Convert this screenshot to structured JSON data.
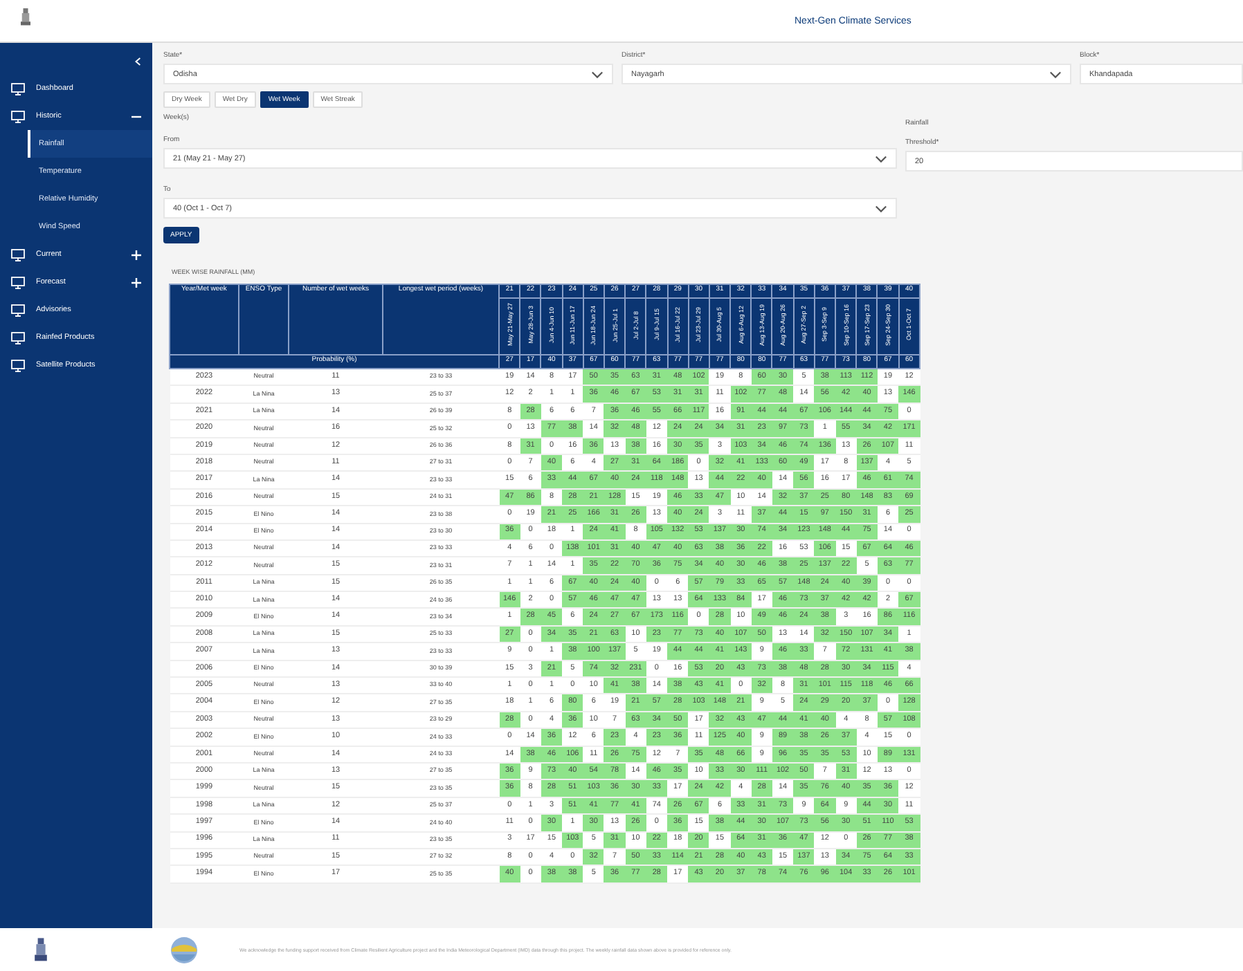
{
  "header": {
    "title": "Next-Gen Climate Services"
  },
  "sidebar": {
    "items": [
      {
        "label": "Dashboard"
      },
      {
        "label": "Historic",
        "expanded": true,
        "children": [
          {
            "label": "Rainfall",
            "selected": true
          },
          {
            "label": "Temperature",
            "selected": false
          },
          {
            "label": "Relative Humidity",
            "selected": false
          },
          {
            "label": "Wind Speed",
            "selected": false
          }
        ]
      },
      {
        "label": "Current",
        "expanded": false
      },
      {
        "label": "Forecast",
        "expanded": false
      },
      {
        "label": "Advisories"
      },
      {
        "label": "Rainfed Products"
      },
      {
        "label": "Satellite Products"
      }
    ]
  },
  "filters": [
    {
      "label": "State*",
      "value": "Odisha"
    },
    {
      "label": "District*",
      "value": "Nayagarh"
    },
    {
      "label": "Block*",
      "value": "Khandapada"
    }
  ],
  "tabs": [
    {
      "label": "Dry Week",
      "selected": false
    },
    {
      "label": "Wet Dry",
      "selected": false
    },
    {
      "label": "Wet Week",
      "selected": true
    },
    {
      "label": "Wet Streak",
      "selected": false
    }
  ],
  "weeks_section": {
    "label": "Week(s)",
    "from": {
      "label": "From",
      "value": "21 (May 21 - May 27)"
    },
    "to": {
      "label": "To",
      "value": "40 (Oct 1 - Oct 7)"
    },
    "apply": "APPLY"
  },
  "rainfall_section": {
    "label": "Rainfall",
    "threshold": {
      "label": "Threshold*",
      "value": "20"
    }
  },
  "table": {
    "caption": "WEEK WISE RAINFALL (MM)",
    "columns": [
      "Year/Met week",
      "ENSO Type",
      "Number of wet weeks",
      "Longest wet period (weeks)"
    ],
    "weeks": [
      {
        "number": "21",
        "dates": "May 21-May 27"
      },
      {
        "number": "22",
        "dates": "May 28-Jun 3"
      },
      {
        "number": "23",
        "dates": "Jun 4-Jun 10"
      },
      {
        "number": "24",
        "dates": "Jun 11-Jun 17"
      },
      {
        "number": "25",
        "dates": "Jun 18-Jun 24"
      },
      {
        "number": "26",
        "dates": "Jun 25-Jul 1"
      },
      {
        "number": "27",
        "dates": "Jul 2-Jul 8"
      },
      {
        "number": "28",
        "dates": "Jul 9-Jul 15"
      },
      {
        "number": "29",
        "dates": "Jul 16-Jul 22"
      },
      {
        "number": "30",
        "dates": "Jul 23-Jul 29"
      },
      {
        "number": "31",
        "dates": "Jul 30-Aug 5"
      },
      {
        "number": "32",
        "dates": "Aug 6-Aug 12"
      },
      {
        "number": "33",
        "dates": "Aug 13-Aug 19"
      },
      {
        "number": "34",
        "dates": "Aug 20-Aug 26"
      },
      {
        "number": "35",
        "dates": "Aug 27-Sep 2"
      },
      {
        "number": "36",
        "dates": "Sep 3-Sep 9"
      },
      {
        "number": "37",
        "dates": "Sep 10-Sep 16"
      },
      {
        "number": "38",
        "dates": "Sep 17-Sep 23"
      },
      {
        "number": "39",
        "dates": "Sep 24-Sep 30"
      },
      {
        "number": "40",
        "dates": "Oct 1-Oct 7"
      }
    ],
    "probability_label": "Probability (%)",
    "probability": [
      "27",
      "17",
      "40",
      "37",
      "67",
      "60",
      "77",
      "63",
      "77",
      "77",
      "77",
      "80",
      "80",
      "77",
      "63",
      "77",
      "73",
      "80",
      "67",
      "60"
    ],
    "rows": [
      {
        "year": "2023",
        "enso": "Neutral",
        "wet_weeks": "11",
        "longest": "23 to 33",
        "values": [
          "19",
          "14",
          "8",
          "17",
          "50",
          "35",
          "63",
          "31",
          "48",
          "102",
          "19",
          "8",
          "60",
          "30",
          "5",
          "38",
          "113",
          "112",
          "19",
          "12"
        ],
        "wet": [
          false,
          false,
          false,
          false,
          true,
          true,
          true,
          true,
          true,
          true,
          false,
          false,
          true,
          true,
          false,
          true,
          true,
          true,
          false,
          false
        ]
      },
      {
        "year": "2022",
        "enso": "La Nina",
        "wet_weeks": "13",
        "longest": "25 to 37",
        "values": [
          "12",
          "2",
          "1",
          "1",
          "36",
          "46",
          "67",
          "53",
          "31",
          "31",
          "11",
          "102",
          "77",
          "48",
          "14",
          "56",
          "42",
          "40",
          "13",
          "146"
        ],
        "wet": [
          false,
          false,
          false,
          false,
          true,
          true,
          true,
          true,
          true,
          true,
          false,
          true,
          true,
          true,
          false,
          true,
          true,
          true,
          false,
          true
        ]
      },
      {
        "year": "2021",
        "enso": "La Nina",
        "wet_weeks": "14",
        "longest": "26 to 39",
        "values": [
          "8",
          "28",
          "6",
          "6",
          "7",
          "36",
          "46",
          "55",
          "66",
          "117",
          "16",
          "91",
          "44",
          "44",
          "67",
          "106",
          "144",
          "44",
          "75",
          "0"
        ],
        "wet": [
          false,
          true,
          false,
          false,
          false,
          true,
          true,
          true,
          true,
          true,
          false,
          true,
          true,
          true,
          true,
          true,
          true,
          true,
          true,
          false
        ]
      },
      {
        "year": "2020",
        "enso": "Neutral",
        "wet_weeks": "16",
        "longest": "25 to 32",
        "values": [
          "0",
          "13",
          "77",
          "38",
          "14",
          "32",
          "48",
          "12",
          "24",
          "24",
          "34",
          "31",
          "23",
          "97",
          "73",
          "1",
          "55",
          "34",
          "42",
          "171"
        ],
        "wet": [
          false,
          false,
          true,
          true,
          false,
          true,
          true,
          false,
          true,
          true,
          true,
          true,
          true,
          true,
          true,
          false,
          true,
          true,
          true,
          true
        ]
      },
      {
        "year": "2019",
        "enso": "Neutral",
        "wet_weeks": "12",
        "longest": "26 to 36",
        "values": [
          "8",
          "31",
          "0",
          "16",
          "36",
          "13",
          "38",
          "16",
          "30",
          "35",
          "3",
          "103",
          "34",
          "46",
          "74",
          "136",
          "13",
          "26",
          "107",
          "11"
        ],
        "wet": [
          false,
          true,
          false,
          false,
          true,
          false,
          true,
          false,
          true,
          true,
          false,
          true,
          true,
          true,
          true,
          true,
          false,
          true,
          true,
          false
        ]
      },
      {
        "year": "2018",
        "enso": "Neutral",
        "wet_weeks": "11",
        "longest": "27 to 31",
        "values": [
          "0",
          "7",
          "40",
          "6",
          "4",
          "27",
          "31",
          "64",
          "186",
          "0",
          "32",
          "41",
          "133",
          "60",
          "49",
          "17",
          "8",
          "137",
          "4",
          "5"
        ],
        "wet": [
          false,
          false,
          true,
          false,
          false,
          true,
          true,
          true,
          true,
          false,
          true,
          true,
          true,
          true,
          true,
          false,
          false,
          true,
          false,
          false
        ]
      },
      {
        "year": "2017",
        "enso": "La Nina",
        "wet_weeks": "14",
        "longest": "23 to 33",
        "values": [
          "15",
          "6",
          "33",
          "44",
          "67",
          "40",
          "24",
          "118",
          "148",
          "13",
          "44",
          "22",
          "40",
          "14",
          "56",
          "16",
          "17",
          "46",
          "61",
          "74"
        ],
        "wet": [
          false,
          false,
          true,
          true,
          true,
          true,
          true,
          true,
          true,
          false,
          true,
          true,
          true,
          false,
          true,
          false,
          false,
          true,
          true,
          true
        ]
      },
      {
        "year": "2016",
        "enso": "Neutral",
        "wet_weeks": "15",
        "longest": "24 to 31",
        "values": [
          "47",
          "86",
          "8",
          "28",
          "21",
          "128",
          "15",
          "19",
          "46",
          "33",
          "47",
          "10",
          "14",
          "32",
          "37",
          "25",
          "80",
          "148",
          "83",
          "69"
        ],
        "wet": [
          true,
          true,
          false,
          true,
          true,
          true,
          false,
          false,
          true,
          true,
          true,
          false,
          false,
          true,
          true,
          true,
          true,
          true,
          true,
          true
        ]
      },
      {
        "year": "2015",
        "enso": "El Nino",
        "wet_weeks": "14",
        "longest": "23 to 38",
        "values": [
          "0",
          "19",
          "21",
          "25",
          "166",
          "31",
          "26",
          "13",
          "40",
          "24",
          "3",
          "11",
          "37",
          "44",
          "15",
          "97",
          "150",
          "31",
          "6",
          "25"
        ],
        "wet": [
          false,
          false,
          true,
          true,
          true,
          true,
          true,
          false,
          true,
          true,
          false,
          false,
          true,
          true,
          true,
          true,
          true,
          true,
          false,
          true
        ]
      },
      {
        "year": "2014",
        "enso": "El Nino",
        "wet_weeks": "14",
        "longest": "23 to 30",
        "values": [
          "36",
          "0",
          "18",
          "1",
          "24",
          "41",
          "8",
          "105",
          "132",
          "53",
          "137",
          "30",
          "74",
          "34",
          "123",
          "148",
          "44",
          "75",
          "14",
          "0"
        ],
        "wet": [
          true,
          false,
          false,
          false,
          true,
          true,
          false,
          true,
          true,
          true,
          true,
          true,
          true,
          true,
          true,
          true,
          true,
          true,
          false,
          false
        ]
      },
      {
        "year": "2013",
        "enso": "Neutral",
        "wet_weeks": "14",
        "longest": "23 to 33",
        "values": [
          "4",
          "6",
          "0",
          "138",
          "101",
          "31",
          "40",
          "47",
          "40",
          "63",
          "38",
          "36",
          "22",
          "16",
          "53",
          "106",
          "15",
          "67",
          "64",
          "46"
        ],
        "wet": [
          false,
          false,
          false,
          true,
          true,
          true,
          true,
          true,
          true,
          true,
          true,
          true,
          true,
          false,
          false,
          true,
          false,
          true,
          true,
          true
        ]
      },
      {
        "year": "2012",
        "enso": "Neutral",
        "wet_weeks": "15",
        "longest": "23 to 31",
        "values": [
          "7",
          "1",
          "14",
          "1",
          "35",
          "22",
          "70",
          "36",
          "75",
          "34",
          "40",
          "30",
          "46",
          "38",
          "25",
          "137",
          "22",
          "5",
          "63",
          "77"
        ],
        "wet": [
          false,
          false,
          false,
          false,
          true,
          true,
          true,
          true,
          true,
          true,
          true,
          true,
          true,
          true,
          true,
          true,
          true,
          false,
          true,
          true
        ]
      },
      {
        "year": "2011",
        "enso": "La Nina",
        "wet_weeks": "15",
        "longest": "26 to 35",
        "values": [
          "1",
          "1",
          "6",
          "67",
          "40",
          "24",
          "40",
          "0",
          "6",
          "57",
          "79",
          "33",
          "65",
          "57",
          "148",
          "24",
          "40",
          "39",
          "0",
          "0"
        ],
        "wet": [
          false,
          false,
          false,
          true,
          true,
          true,
          true,
          false,
          false,
          true,
          true,
          true,
          true,
          true,
          true,
          true,
          true,
          true,
          false,
          false
        ]
      },
      {
        "year": "2010",
        "enso": "La Nina",
        "wet_weeks": "14",
        "longest": "24 to 36",
        "values": [
          "146",
          "2",
          "0",
          "57",
          "46",
          "47",
          "47",
          "13",
          "13",
          "64",
          "133",
          "84",
          "17",
          "46",
          "73",
          "37",
          "42",
          "42",
          "2",
          "67"
        ],
        "wet": [
          true,
          false,
          false,
          true,
          true,
          true,
          true,
          false,
          false,
          true,
          true,
          true,
          false,
          true,
          true,
          true,
          true,
          true,
          false,
          true
        ]
      },
      {
        "year": "2009",
        "enso": "El Nino",
        "wet_weeks": "14",
        "longest": "23 to 34",
        "values": [
          "1",
          "28",
          "45",
          "6",
          "24",
          "27",
          "67",
          "173",
          "116",
          "0",
          "28",
          "10",
          "49",
          "46",
          "24",
          "38",
          "3",
          "16",
          "86",
          "116"
        ],
        "wet": [
          false,
          true,
          true,
          false,
          true,
          true,
          true,
          true,
          true,
          false,
          true,
          false,
          true,
          true,
          true,
          true,
          false,
          false,
          true,
          true
        ]
      },
      {
        "year": "2008",
        "enso": "La Nina",
        "wet_weeks": "15",
        "longest": "25 to 33",
        "values": [
          "27",
          "0",
          "34",
          "35",
          "21",
          "63",
          "10",
          "23",
          "77",
          "73",
          "40",
          "107",
          "50",
          "13",
          "14",
          "32",
          "150",
          "107",
          "34",
          "1"
        ],
        "wet": [
          true,
          false,
          true,
          true,
          true,
          true,
          false,
          true,
          true,
          true,
          true,
          true,
          true,
          false,
          false,
          true,
          true,
          true,
          true,
          false
        ]
      },
      {
        "year": "2007",
        "enso": "La Nina",
        "wet_weeks": "13",
        "longest": "23 to 33",
        "values": [
          "9",
          "0",
          "1",
          "38",
          "100",
          "137",
          "5",
          "19",
          "44",
          "44",
          "41",
          "143",
          "9",
          "46",
          "33",
          "7",
          "72",
          "131",
          "41",
          "38"
        ],
        "wet": [
          false,
          false,
          false,
          true,
          true,
          true,
          false,
          false,
          true,
          true,
          true,
          true,
          false,
          true,
          true,
          false,
          true,
          true,
          true,
          true
        ]
      },
      {
        "year": "2006",
        "enso": "El Nino",
        "wet_weeks": "14",
        "longest": "30 to 39",
        "values": [
          "15",
          "3",
          "21",
          "5",
          "74",
          "32",
          "231",
          "0",
          "16",
          "53",
          "20",
          "43",
          "73",
          "38",
          "48",
          "28",
          "30",
          "34",
          "115",
          "4"
        ],
        "wet": [
          false,
          false,
          true,
          false,
          true,
          true,
          true,
          false,
          false,
          true,
          true,
          true,
          true,
          true,
          true,
          true,
          true,
          true,
          true,
          false
        ]
      },
      {
        "year": "2005",
        "enso": "Neutral",
        "wet_weeks": "13",
        "longest": "33 to 40",
        "values": [
          "1",
          "0",
          "1",
          "0",
          "10",
          "41",
          "38",
          "14",
          "38",
          "43",
          "41",
          "0",
          "32",
          "8",
          "31",
          "101",
          "115",
          "118",
          "46",
          "66"
        ],
        "wet": [
          false,
          false,
          false,
          false,
          false,
          true,
          true,
          false,
          true,
          true,
          true,
          false,
          true,
          false,
          true,
          true,
          true,
          true,
          true,
          true
        ]
      },
      {
        "year": "2004",
        "enso": "El Nino",
        "wet_weeks": "12",
        "longest": "27 to 35",
        "values": [
          "18",
          "1",
          "6",
          "80",
          "6",
          "19",
          "21",
          "57",
          "28",
          "103",
          "148",
          "21",
          "9",
          "5",
          "24",
          "29",
          "20",
          "37",
          "0",
          "128"
        ],
        "wet": [
          false,
          false,
          false,
          true,
          false,
          false,
          true,
          true,
          true,
          true,
          true,
          true,
          false,
          false,
          true,
          true,
          true,
          true,
          false,
          true
        ]
      },
      {
        "year": "2003",
        "enso": "Neutral",
        "wet_weeks": "13",
        "longest": "23 to 29",
        "values": [
          "28",
          "0",
          "4",
          "36",
          "10",
          "7",
          "63",
          "34",
          "50",
          "17",
          "32",
          "43",
          "47",
          "44",
          "41",
          "40",
          "4",
          "8",
          "57",
          "108"
        ],
        "wet": [
          true,
          false,
          false,
          true,
          false,
          false,
          true,
          true,
          true,
          false,
          true,
          true,
          true,
          true,
          true,
          true,
          false,
          false,
          true,
          true
        ]
      },
      {
        "year": "2002",
        "enso": "El Nino",
        "wet_weeks": "10",
        "longest": "24 to 33",
        "values": [
          "0",
          "14",
          "36",
          "12",
          "6",
          "23",
          "4",
          "23",
          "36",
          "11",
          "125",
          "40",
          "9",
          "89",
          "38",
          "26",
          "37",
          "4",
          "15",
          "0"
        ],
        "wet": [
          false,
          false,
          true,
          false,
          false,
          true,
          false,
          true,
          true,
          false,
          true,
          true,
          false,
          true,
          true,
          true,
          true,
          false,
          false,
          false
        ]
      },
      {
        "year": "2001",
        "enso": "Neutral",
        "wet_weeks": "14",
        "longest": "24 to 33",
        "values": [
          "14",
          "38",
          "46",
          "106",
          "11",
          "26",
          "75",
          "12",
          "7",
          "35",
          "48",
          "66",
          "9",
          "96",
          "35",
          "35",
          "53",
          "10",
          "89",
          "131"
        ],
        "wet": [
          false,
          true,
          true,
          true,
          false,
          true,
          true,
          false,
          false,
          true,
          true,
          true,
          false,
          true,
          true,
          true,
          true,
          false,
          true,
          true
        ]
      },
      {
        "year": "2000",
        "enso": "La Nina",
        "wet_weeks": "13",
        "longest": "27 to 35",
        "values": [
          "36",
          "9",
          "73",
          "40",
          "54",
          "78",
          "14",
          "46",
          "35",
          "10",
          "33",
          "30",
          "111",
          "102",
          "50",
          "7",
          "31",
          "12",
          "13",
          "0"
        ],
        "wet": [
          true,
          false,
          true,
          true,
          true,
          true,
          false,
          true,
          true,
          false,
          true,
          true,
          true,
          true,
          true,
          false,
          true,
          false,
          false,
          false
        ]
      },
      {
        "year": "1999",
        "enso": "Neutral",
        "wet_weeks": "15",
        "longest": "23 to 35",
        "values": [
          "36",
          "8",
          "28",
          "51",
          "103",
          "36",
          "30",
          "33",
          "17",
          "24",
          "42",
          "4",
          "28",
          "14",
          "35",
          "76",
          "40",
          "35",
          "36",
          "12"
        ],
        "wet": [
          true,
          false,
          true,
          true,
          true,
          true,
          true,
          true,
          false,
          true,
          true,
          false,
          true,
          false,
          true,
          true,
          true,
          true,
          true,
          false
        ]
      },
      {
        "year": "1998",
        "enso": "La Nina",
        "wet_weeks": "12",
        "longest": "25 to 37",
        "values": [
          "0",
          "1",
          "3",
          "51",
          "41",
          "77",
          "41",
          "74",
          "26",
          "67",
          "6",
          "33",
          "31",
          "73",
          "9",
          "64",
          "9",
          "44",
          "30",
          "11"
        ],
        "wet": [
          false,
          false,
          false,
          true,
          true,
          true,
          true,
          false,
          true,
          true,
          false,
          true,
          true,
          true,
          false,
          true,
          false,
          true,
          true,
          false
        ]
      },
      {
        "year": "1997",
        "enso": "El Nino",
        "wet_weeks": "14",
        "longest": "24 to 40",
        "values": [
          "11",
          "0",
          "30",
          "1",
          "30",
          "13",
          "26",
          "0",
          "36",
          "15",
          "38",
          "44",
          "30",
          "107",
          "73",
          "56",
          "30",
          "51",
          "110",
          "53"
        ],
        "wet": [
          false,
          false,
          true,
          false,
          true,
          false,
          true,
          false,
          true,
          false,
          true,
          true,
          true,
          true,
          true,
          true,
          true,
          true,
          true,
          true
        ]
      },
      {
        "year": "1996",
        "enso": "La Nina",
        "wet_weeks": "11",
        "longest": "23 to 35",
        "values": [
          "3",
          "17",
          "15",
          "103",
          "5",
          "31",
          "10",
          "22",
          "18",
          "20",
          "15",
          "64",
          "31",
          "36",
          "47",
          "12",
          "0",
          "26",
          "77",
          "38"
        ],
        "wet": [
          false,
          false,
          false,
          true,
          false,
          true,
          false,
          true,
          false,
          true,
          false,
          true,
          true,
          true,
          true,
          false,
          false,
          true,
          true,
          true
        ]
      },
      {
        "year": "1995",
        "enso": "Neutral",
        "wet_weeks": "15",
        "longest": "27 to 32",
        "values": [
          "8",
          "0",
          "4",
          "0",
          "32",
          "7",
          "50",
          "33",
          "114",
          "21",
          "28",
          "40",
          "43",
          "15",
          "137",
          "13",
          "34",
          "75",
          "64",
          "33"
        ],
        "wet": [
          false,
          false,
          false,
          false,
          true,
          false,
          true,
          true,
          true,
          true,
          true,
          true,
          true,
          false,
          true,
          false,
          true,
          true,
          true,
          true
        ]
      },
      {
        "year": "1994",
        "enso": "El Nino",
        "wet_weeks": "17",
        "longest": "25 to 35",
        "values": [
          "40",
          "0",
          "38",
          "38",
          "5",
          "36",
          "77",
          "28",
          "17",
          "43",
          "20",
          "37",
          "78",
          "74",
          "76",
          "96",
          "104",
          "33",
          "26",
          "101"
        ],
        "wet": [
          true,
          false,
          true,
          true,
          false,
          true,
          true,
          true,
          false,
          true,
          true,
          true,
          true,
          true,
          true,
          true,
          true,
          true,
          true,
          true
        ]
      }
    ]
  },
  "footer": {
    "text": "We acknowledge the funding support received from Climate Resilient Agriculture project and the India Meteorological Department (IMD) data through this project. The weekly rainfall data shown above is provided for reference only."
  }
}
